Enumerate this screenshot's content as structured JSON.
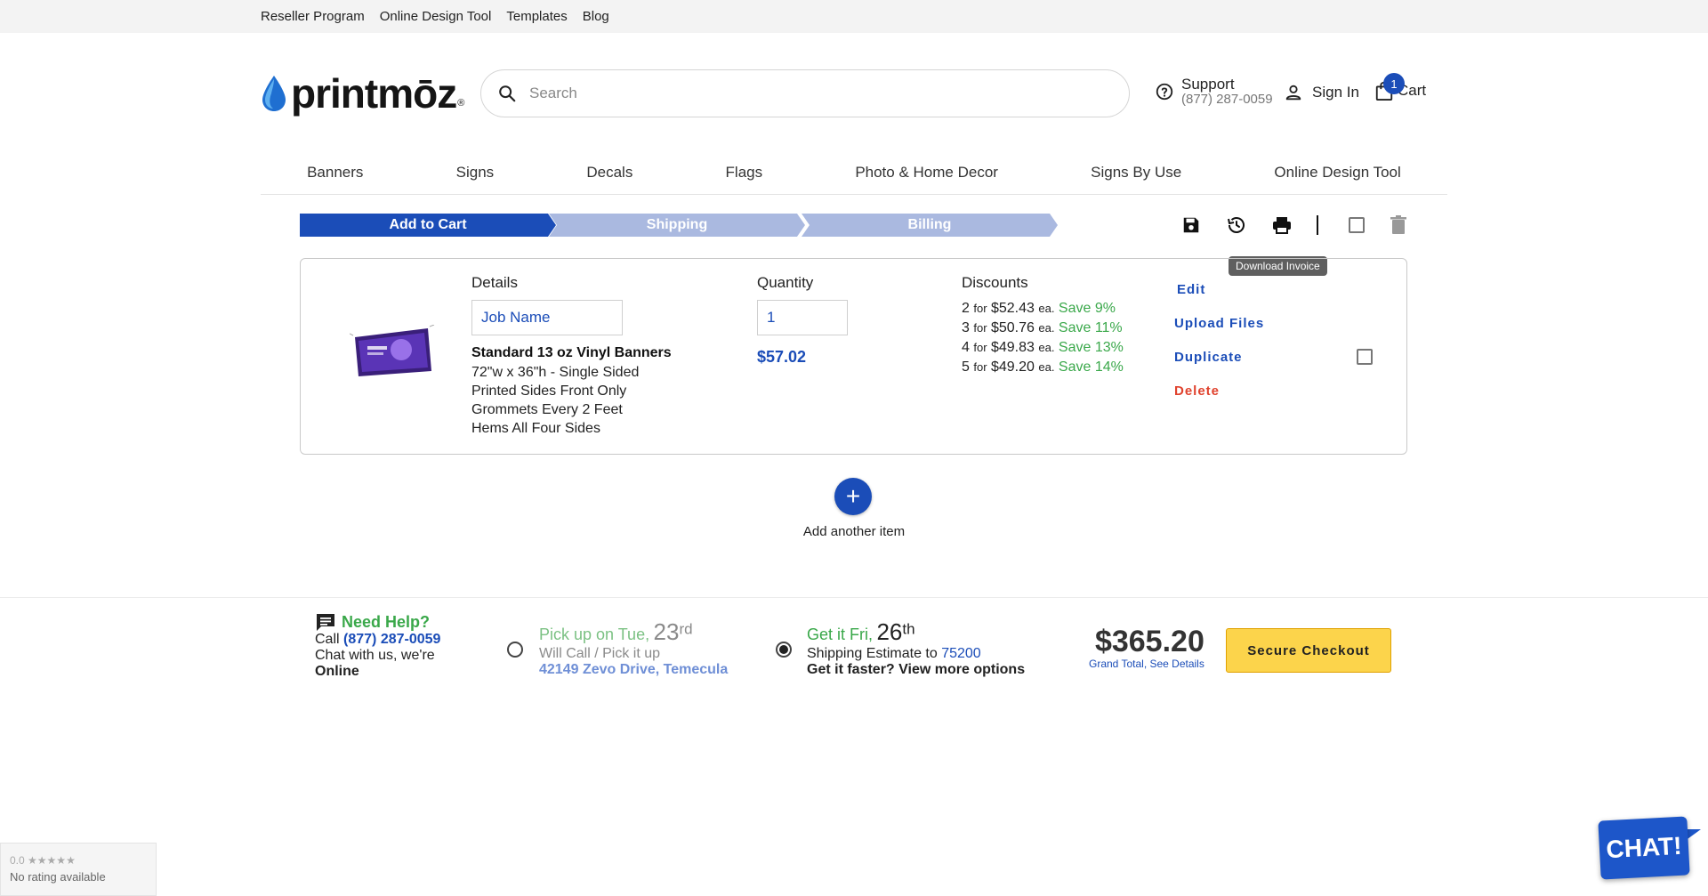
{
  "topbar": {
    "links": [
      "Reseller Program",
      "Online Design Tool",
      "Templates",
      "Blog"
    ]
  },
  "header": {
    "logo_text": "printmōz",
    "search_placeholder": "Search",
    "support_label": "Support",
    "support_phone": "(877) 287-0059",
    "signin_label": "Sign In",
    "cart_label": "Cart",
    "cart_count": "1"
  },
  "nav": {
    "items": [
      "Banners",
      "Signs",
      "Decals",
      "Flags",
      "Photo & Home Decor",
      "Signs By Use",
      "Online Design Tool"
    ]
  },
  "steps": {
    "items": [
      "Add to Cart",
      "Shipping",
      "Billing"
    ],
    "active_color": "#1b4db8",
    "inactive_color": "#aab9e0"
  },
  "toolbar": {
    "tooltip": "Download Invoice",
    "icons": [
      "save-icon",
      "history-icon",
      "print-icon",
      "checkbox",
      "trash-icon"
    ]
  },
  "cart_item": {
    "details_label": "Details",
    "job_name_placeholder": "Job Name",
    "product_title": "Standard 13 oz Vinyl Banners",
    "specs": [
      "72\"w x 36\"h - Single Sided",
      "Printed Sides Front Only",
      "Grommets Every 2 Feet",
      "Hems All Four Sides"
    ],
    "quantity_label": "Quantity",
    "quantity_value": "1",
    "price": "$57.02",
    "discounts_label": "Discounts",
    "discounts": [
      {
        "qty": "2",
        "for": "for",
        "price": "$52.43",
        "ea": "ea.",
        "save": "Save 9%"
      },
      {
        "qty": "3",
        "for": "for",
        "price": "$50.76",
        "ea": "ea.",
        "save": "Save 11%"
      },
      {
        "qty": "4",
        "for": "for",
        "price": "$49.83",
        "ea": "ea.",
        "save": "Save 13%"
      },
      {
        "qty": "5",
        "for": "for",
        "price": "$49.20",
        "ea": "ea.",
        "save": "Save 14%"
      }
    ],
    "actions": {
      "edit": "Edit",
      "upload": "Upload Files",
      "duplicate": "Duplicate",
      "delete": "Delete"
    }
  },
  "add_item": {
    "plus": "+",
    "label": "Add another item"
  },
  "footer": {
    "help_title": "Need Help?",
    "help_call_prefix": "Call",
    "help_phone": "(877) 287-0059",
    "help_chat": "Chat with us, we're",
    "help_status": "Online",
    "pickup_prefix": "Pick up on Tue,",
    "pickup_day": "23",
    "pickup_suffix": "rd",
    "pickup_line2": "Will Call / Pick it up",
    "pickup_address": "42149 Zevo Drive, Temecula",
    "ship_prefix": "Get it Fri,",
    "ship_day": "26",
    "ship_suffix": "th",
    "ship_line2_prefix": "Shipping Estimate to",
    "ship_zip": "75200",
    "ship_faster": "Get it faster? View more options",
    "grand_total": "$365.20",
    "grand_total_label": "Grand Total, See Details",
    "checkout_label": "Secure Checkout"
  },
  "rating_widget": {
    "score": "0.0",
    "stars": "★★★★★",
    "text": "No rating available"
  },
  "chat_widget": {
    "label": "CHAT!"
  },
  "colors": {
    "brand_blue": "#1b4db8",
    "green": "#3aa84a",
    "red": "#e0422d",
    "checkout_yellow": "#fcd44b"
  }
}
